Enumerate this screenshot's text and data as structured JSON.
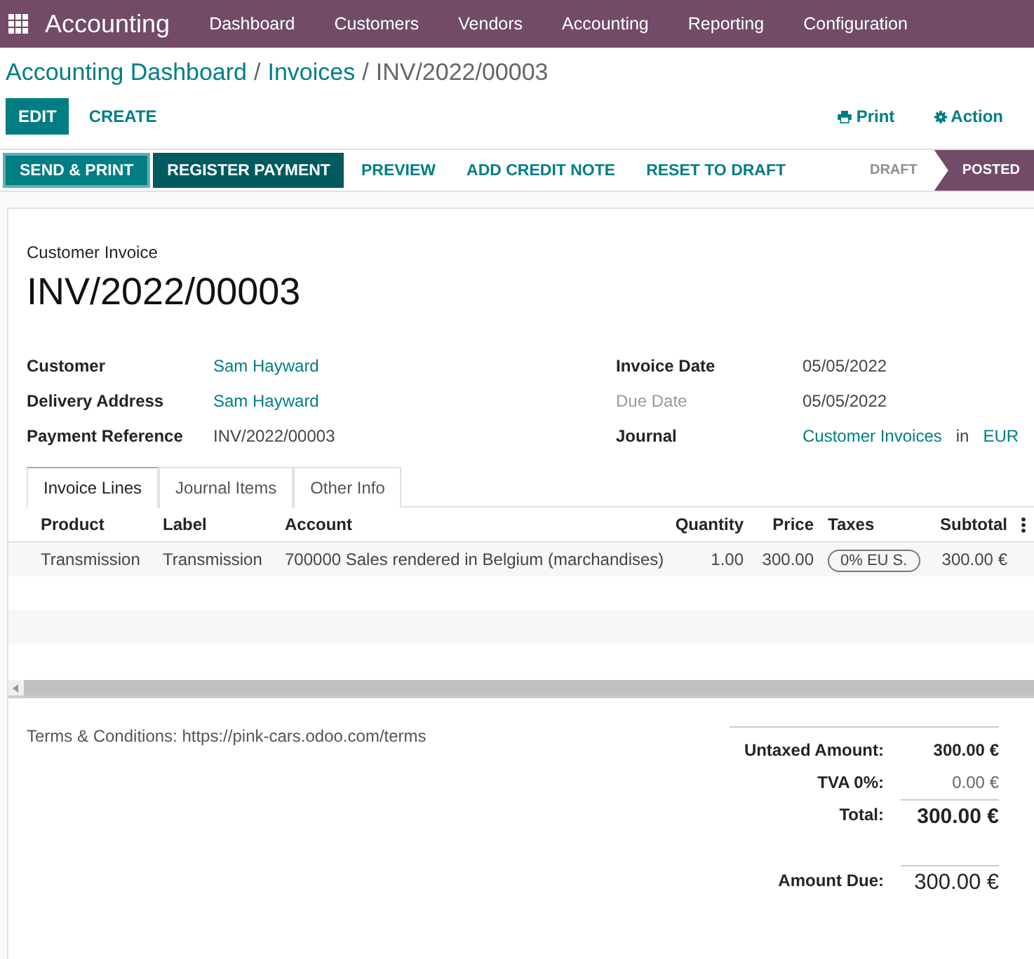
{
  "navbar": {
    "app": "Accounting",
    "menu": [
      "Dashboard",
      "Customers",
      "Vendors",
      "Accounting",
      "Reporting",
      "Configuration"
    ]
  },
  "breadcrumb": [
    {
      "text": "Accounting Dashboard",
      "kind": "link"
    },
    {
      "text": "/",
      "kind": "separator"
    },
    {
      "text": "Invoices",
      "kind": "link"
    },
    {
      "text": "/",
      "kind": "separator"
    },
    {
      "text": "INV/2022/00003",
      "kind": "current"
    }
  ],
  "actions": {
    "primary": "EDIT",
    "secondary": "CREATE",
    "print": "Print",
    "action": "Action"
  },
  "statusbar": {
    "buttons": [
      {
        "label": "SEND & PRINT",
        "kind": "primary"
      },
      {
        "label": "REGISTER PAYMENT",
        "kind": "dark"
      },
      {
        "label": "PREVIEW",
        "kind": "link"
      },
      {
        "label": "ADD CREDIT NOTE",
        "kind": "link"
      },
      {
        "label": "RESET TO DRAFT",
        "kind": "link"
      }
    ],
    "stages": [
      {
        "label": "DRAFT",
        "selected": false
      },
      {
        "label": "POSTED",
        "selected": true
      }
    ]
  },
  "invoice": {
    "type": "Customer Invoice",
    "number": "INV/2022/00003",
    "left_fields": [
      {
        "label": "Customer",
        "muted": false,
        "value": [
          {
            "text": "Sam Hayward",
            "link": true
          }
        ]
      },
      {
        "label": "Delivery Address",
        "muted": false,
        "value": [
          {
            "text": "Sam Hayward",
            "link": true
          }
        ]
      },
      {
        "label": "Payment Reference",
        "muted": false,
        "value": [
          {
            "text": "INV/2022/00003",
            "link": false
          }
        ]
      }
    ],
    "right_fields": [
      {
        "label": "Invoice Date",
        "muted": false,
        "value": [
          {
            "text": "05/05/2022",
            "link": false
          }
        ]
      },
      {
        "label": "Due Date",
        "muted": true,
        "value": [
          {
            "text": "05/05/2022",
            "link": false
          }
        ]
      },
      {
        "label": "Journal",
        "muted": false,
        "value": [
          {
            "text": "Customer Invoices",
            "link": true
          },
          {
            "text": "in",
            "link": false
          },
          {
            "text": "EUR",
            "link": true
          }
        ]
      }
    ]
  },
  "tabs": [
    {
      "label": "Invoice Lines",
      "selected": true
    },
    {
      "label": "Journal Items",
      "selected": false
    },
    {
      "label": "Other Info",
      "selected": false
    }
  ],
  "table": {
    "columns": [
      "Product",
      "Label",
      "Account",
      "Quantity",
      "Price",
      "Taxes",
      "Subtotal"
    ],
    "rows": [
      {
        "cells": [
          {
            "text": "Transmission",
            "kind": "text"
          },
          {
            "text": "Transmission",
            "kind": "text"
          },
          {
            "text": "700000 Sales rendered in Belgium (marchandises)",
            "kind": "text"
          },
          {
            "text": "1.00",
            "kind": "text"
          },
          {
            "text": "300.00",
            "kind": "text"
          },
          {
            "text": "0% EU S.",
            "kind": "tag"
          },
          {
            "text": "300.00 €",
            "kind": "text"
          }
        ]
      }
    ]
  },
  "terms": "Terms & Conditions: https://pink-cars.odoo.com/terms",
  "totals": [
    {
      "label": "Untaxed Amount:",
      "value": "300.00 €",
      "kind": "subtotal"
    },
    {
      "label": "TVA 0%:",
      "value": "0.00 €",
      "kind": "tax"
    },
    {
      "label": "Total:",
      "value": "300.00 €",
      "kind": "total"
    },
    {
      "label": "Amount Due:",
      "value": "300.00 €",
      "kind": "due"
    }
  ]
}
